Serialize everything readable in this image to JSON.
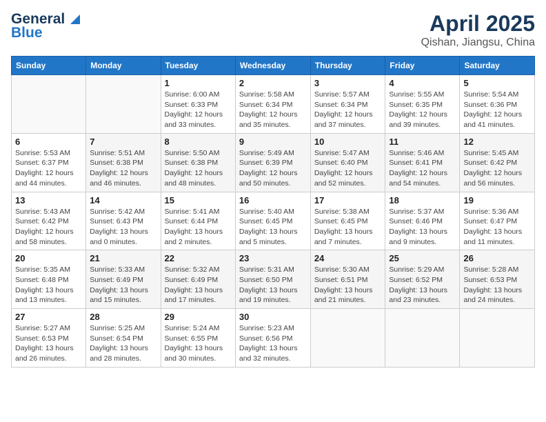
{
  "header": {
    "logo_general": "General",
    "logo_blue": "Blue",
    "title": "April 2025",
    "subtitle": "Qishan, Jiangsu, China"
  },
  "weekdays": [
    "Sunday",
    "Monday",
    "Tuesday",
    "Wednesday",
    "Thursday",
    "Friday",
    "Saturday"
  ],
  "weeks": [
    [
      {
        "day": "",
        "sunrise": "",
        "sunset": "",
        "daylight": ""
      },
      {
        "day": "",
        "sunrise": "",
        "sunset": "",
        "daylight": ""
      },
      {
        "day": "1",
        "sunrise": "Sunrise: 6:00 AM",
        "sunset": "Sunset: 6:33 PM",
        "daylight": "Daylight: 12 hours and 33 minutes."
      },
      {
        "day": "2",
        "sunrise": "Sunrise: 5:58 AM",
        "sunset": "Sunset: 6:34 PM",
        "daylight": "Daylight: 12 hours and 35 minutes."
      },
      {
        "day": "3",
        "sunrise": "Sunrise: 5:57 AM",
        "sunset": "Sunset: 6:34 PM",
        "daylight": "Daylight: 12 hours and 37 minutes."
      },
      {
        "day": "4",
        "sunrise": "Sunrise: 5:55 AM",
        "sunset": "Sunset: 6:35 PM",
        "daylight": "Daylight: 12 hours and 39 minutes."
      },
      {
        "day": "5",
        "sunrise": "Sunrise: 5:54 AM",
        "sunset": "Sunset: 6:36 PM",
        "daylight": "Daylight: 12 hours and 41 minutes."
      }
    ],
    [
      {
        "day": "6",
        "sunrise": "Sunrise: 5:53 AM",
        "sunset": "Sunset: 6:37 PM",
        "daylight": "Daylight: 12 hours and 44 minutes."
      },
      {
        "day": "7",
        "sunrise": "Sunrise: 5:51 AM",
        "sunset": "Sunset: 6:38 PM",
        "daylight": "Daylight: 12 hours and 46 minutes."
      },
      {
        "day": "8",
        "sunrise": "Sunrise: 5:50 AM",
        "sunset": "Sunset: 6:38 PM",
        "daylight": "Daylight: 12 hours and 48 minutes."
      },
      {
        "day": "9",
        "sunrise": "Sunrise: 5:49 AM",
        "sunset": "Sunset: 6:39 PM",
        "daylight": "Daylight: 12 hours and 50 minutes."
      },
      {
        "day": "10",
        "sunrise": "Sunrise: 5:47 AM",
        "sunset": "Sunset: 6:40 PM",
        "daylight": "Daylight: 12 hours and 52 minutes."
      },
      {
        "day": "11",
        "sunrise": "Sunrise: 5:46 AM",
        "sunset": "Sunset: 6:41 PM",
        "daylight": "Daylight: 12 hours and 54 minutes."
      },
      {
        "day": "12",
        "sunrise": "Sunrise: 5:45 AM",
        "sunset": "Sunset: 6:42 PM",
        "daylight": "Daylight: 12 hours and 56 minutes."
      }
    ],
    [
      {
        "day": "13",
        "sunrise": "Sunrise: 5:43 AM",
        "sunset": "Sunset: 6:42 PM",
        "daylight": "Daylight: 12 hours and 58 minutes."
      },
      {
        "day": "14",
        "sunrise": "Sunrise: 5:42 AM",
        "sunset": "Sunset: 6:43 PM",
        "daylight": "Daylight: 13 hours and 0 minutes."
      },
      {
        "day": "15",
        "sunrise": "Sunrise: 5:41 AM",
        "sunset": "Sunset: 6:44 PM",
        "daylight": "Daylight: 13 hours and 2 minutes."
      },
      {
        "day": "16",
        "sunrise": "Sunrise: 5:40 AM",
        "sunset": "Sunset: 6:45 PM",
        "daylight": "Daylight: 13 hours and 5 minutes."
      },
      {
        "day": "17",
        "sunrise": "Sunrise: 5:38 AM",
        "sunset": "Sunset: 6:45 PM",
        "daylight": "Daylight: 13 hours and 7 minutes."
      },
      {
        "day": "18",
        "sunrise": "Sunrise: 5:37 AM",
        "sunset": "Sunset: 6:46 PM",
        "daylight": "Daylight: 13 hours and 9 minutes."
      },
      {
        "day": "19",
        "sunrise": "Sunrise: 5:36 AM",
        "sunset": "Sunset: 6:47 PM",
        "daylight": "Daylight: 13 hours and 11 minutes."
      }
    ],
    [
      {
        "day": "20",
        "sunrise": "Sunrise: 5:35 AM",
        "sunset": "Sunset: 6:48 PM",
        "daylight": "Daylight: 13 hours and 13 minutes."
      },
      {
        "day": "21",
        "sunrise": "Sunrise: 5:33 AM",
        "sunset": "Sunset: 6:49 PM",
        "daylight": "Daylight: 13 hours and 15 minutes."
      },
      {
        "day": "22",
        "sunrise": "Sunrise: 5:32 AM",
        "sunset": "Sunset: 6:49 PM",
        "daylight": "Daylight: 13 hours and 17 minutes."
      },
      {
        "day": "23",
        "sunrise": "Sunrise: 5:31 AM",
        "sunset": "Sunset: 6:50 PM",
        "daylight": "Daylight: 13 hours and 19 minutes."
      },
      {
        "day": "24",
        "sunrise": "Sunrise: 5:30 AM",
        "sunset": "Sunset: 6:51 PM",
        "daylight": "Daylight: 13 hours and 21 minutes."
      },
      {
        "day": "25",
        "sunrise": "Sunrise: 5:29 AM",
        "sunset": "Sunset: 6:52 PM",
        "daylight": "Daylight: 13 hours and 23 minutes."
      },
      {
        "day": "26",
        "sunrise": "Sunrise: 5:28 AM",
        "sunset": "Sunset: 6:53 PM",
        "daylight": "Daylight: 13 hours and 24 minutes."
      }
    ],
    [
      {
        "day": "27",
        "sunrise": "Sunrise: 5:27 AM",
        "sunset": "Sunset: 6:53 PM",
        "daylight": "Daylight: 13 hours and 26 minutes."
      },
      {
        "day": "28",
        "sunrise": "Sunrise: 5:25 AM",
        "sunset": "Sunset: 6:54 PM",
        "daylight": "Daylight: 13 hours and 28 minutes."
      },
      {
        "day": "29",
        "sunrise": "Sunrise: 5:24 AM",
        "sunset": "Sunset: 6:55 PM",
        "daylight": "Daylight: 13 hours and 30 minutes."
      },
      {
        "day": "30",
        "sunrise": "Sunrise: 5:23 AM",
        "sunset": "Sunset: 6:56 PM",
        "daylight": "Daylight: 13 hours and 32 minutes."
      },
      {
        "day": "",
        "sunrise": "",
        "sunset": "",
        "daylight": ""
      },
      {
        "day": "",
        "sunrise": "",
        "sunset": "",
        "daylight": ""
      },
      {
        "day": "",
        "sunrise": "",
        "sunset": "",
        "daylight": ""
      }
    ]
  ]
}
